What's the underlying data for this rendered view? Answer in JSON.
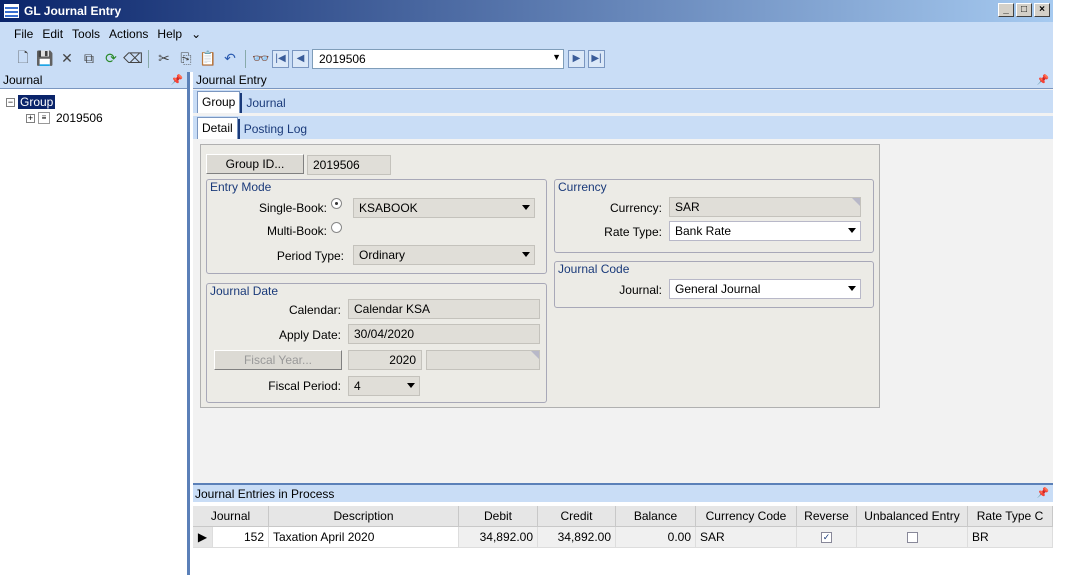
{
  "window": {
    "title": "GL Journal Entry"
  },
  "menu": [
    "File",
    "Edit",
    "Tools",
    "Actions",
    "Help"
  ],
  "toolbar": {
    "journal_value": "2019506"
  },
  "left": {
    "header": "Journal",
    "tree_root": "Group",
    "tree_child": "2019506"
  },
  "main": {
    "header": "Journal Entry",
    "tabs1": [
      "Group",
      "Journal"
    ],
    "tabs2": [
      "Detail",
      "Posting Log"
    ],
    "group_id_button": "Group ID...",
    "group_id_value": "2019506",
    "entry_mode": {
      "title": "Entry Mode",
      "single_book_label": "Single-Book:",
      "single_book_value": "KSABOOK",
      "multi_book_label": "Multi-Book:",
      "period_type_label": "Period Type:",
      "period_type_value": "Ordinary"
    },
    "journal_date": {
      "title": "Journal Date",
      "calendar_label": "Calendar:",
      "calendar_value": "Calendar KSA",
      "apply_date_label": "Apply Date:",
      "apply_date_value": "30/04/2020",
      "fiscal_year_button": "Fiscal Year...",
      "fiscal_year_value": "2020",
      "fiscal_period_label": "Fiscal Period:",
      "fiscal_period_value": "4"
    },
    "currency": {
      "title": "Currency",
      "currency_label": "Currency:",
      "currency_value": "SAR",
      "rate_type_label": "Rate Type:",
      "rate_type_value": "Bank Rate"
    },
    "journal_code": {
      "title": "Journal Code",
      "journal_label": "Journal:",
      "journal_value": "General Journal"
    }
  },
  "bottom": {
    "header": "Journal Entries in Process",
    "columns": [
      "Journal",
      "Description",
      "Debit",
      "Credit",
      "Balance",
      "Currency Code",
      "Reverse",
      "Unbalanced Entry",
      "Rate Type C"
    ],
    "row": {
      "journal": "152",
      "description": "Taxation April 2020",
      "debit": "34,892.00",
      "credit": "34,892.00",
      "balance": "0.00",
      "currency": "SAR",
      "reverse": true,
      "unbalanced": false,
      "rate_type": "BR"
    }
  }
}
